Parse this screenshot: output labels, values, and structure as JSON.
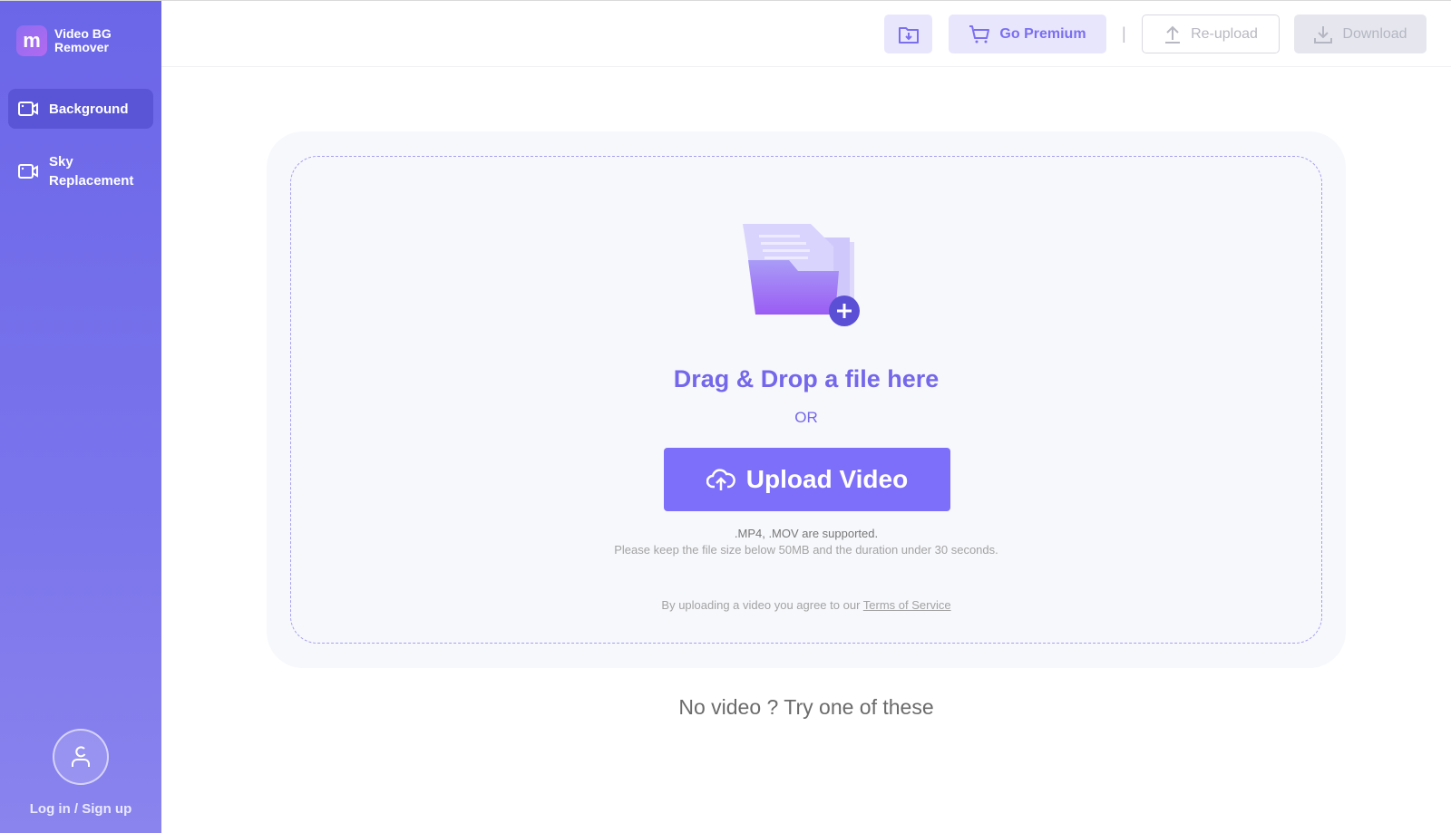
{
  "app": {
    "logo_letter": "m",
    "name_line1": "Video BG",
    "name_line2": "Remover",
    "accent": "#7d6ff9",
    "sidebar_color": "#6b66e8"
  },
  "sidebar": {
    "items": [
      {
        "label": "Background",
        "icon": "video-icon",
        "active": true
      },
      {
        "label_line1": "Sky",
        "label_line2": "Replacement",
        "icon": "video-icon",
        "active": false
      }
    ],
    "login_label": "Log in / Sign up"
  },
  "toolbar": {
    "save_icon": "folder-download-icon",
    "premium_label": "Go Premium",
    "separator": "|",
    "reupload_label": "Re-upload",
    "download_label": "Download"
  },
  "upload": {
    "title": "Drag & Drop a file here",
    "or": "OR",
    "button_label": "Upload Video",
    "formats": ".MP4, .MOV are supported.",
    "limits": "Please keep the file size below 50MB and the duration under 30 seconds.",
    "terms_prefix": "By uploading a video you agree to our ",
    "terms_link": "Terms of Service"
  },
  "samples": {
    "prompt": "No video ? Try one of these"
  }
}
